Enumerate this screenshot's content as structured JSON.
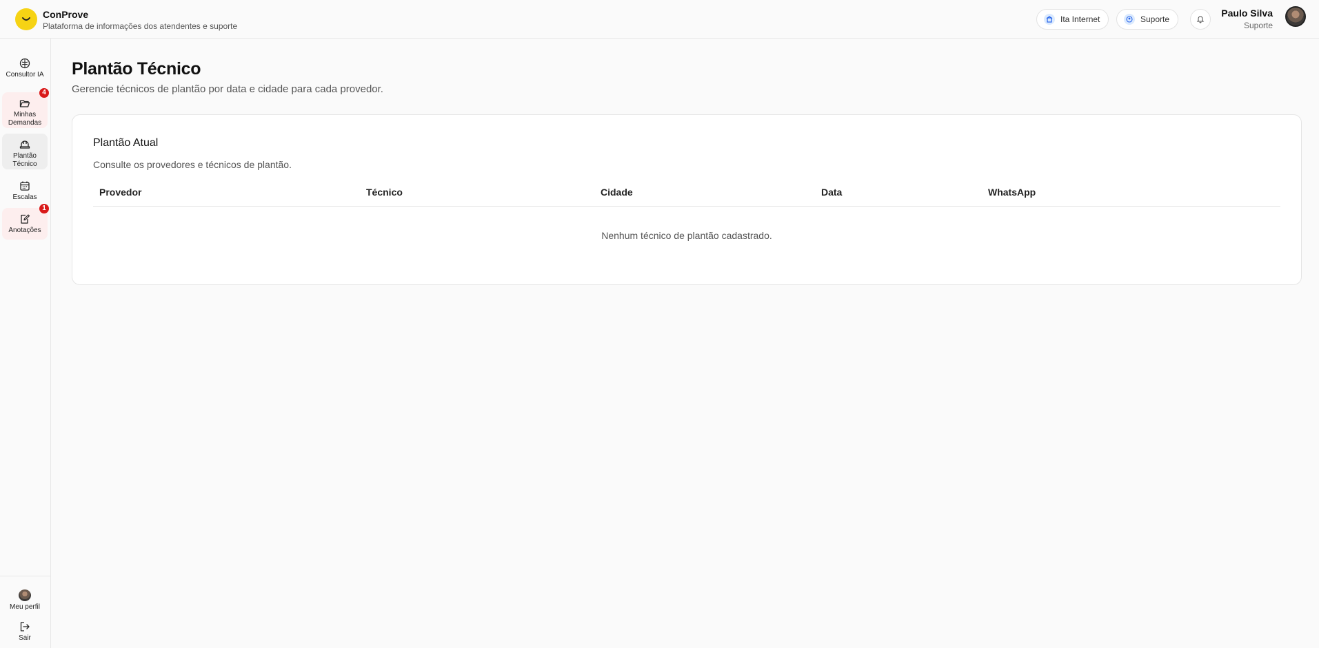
{
  "app": {
    "title": "ConProve",
    "subtitle": "Plataforma de informações dos atendentes e suporte"
  },
  "header": {
    "provider_pill": "Ita Internet",
    "role_pill": "Suporte",
    "user_name": "Paulo Silva",
    "user_role": "Suporte"
  },
  "sidebar": {
    "items": [
      {
        "label": "Consultor IA",
        "icon": "brain-icon"
      },
      {
        "label": "Minhas Demandas",
        "icon": "folder-open-icon",
        "badge": "4"
      },
      {
        "label": "Plantão Técnico",
        "icon": "hard-hat-icon"
      },
      {
        "label": "Escalas",
        "icon": "calendar-icon"
      },
      {
        "label": "Anotações",
        "icon": "edit-note-icon",
        "badge": "1"
      }
    ],
    "bottom": [
      {
        "label": "Meu perfil",
        "icon": "avatar"
      },
      {
        "label": "Sair",
        "icon": "logout-icon"
      }
    ]
  },
  "page": {
    "title": "Plantão Técnico",
    "subtitle": "Gerencie técnicos de plantão por data e cidade para cada provedor."
  },
  "card": {
    "title": "Plantão Atual",
    "subtitle": "Consulte os provedores e técnicos de plantão.",
    "columns": [
      "Provedor",
      "Técnico",
      "Cidade",
      "Data",
      "WhatsApp"
    ],
    "empty_message": "Nenhum técnico de plantão cadastrado."
  },
  "colors": {
    "brand": "#f6d314",
    "badge": "#d91a1a",
    "active_nav": "#eeeeee",
    "alert_nav": "#fdeeee"
  }
}
